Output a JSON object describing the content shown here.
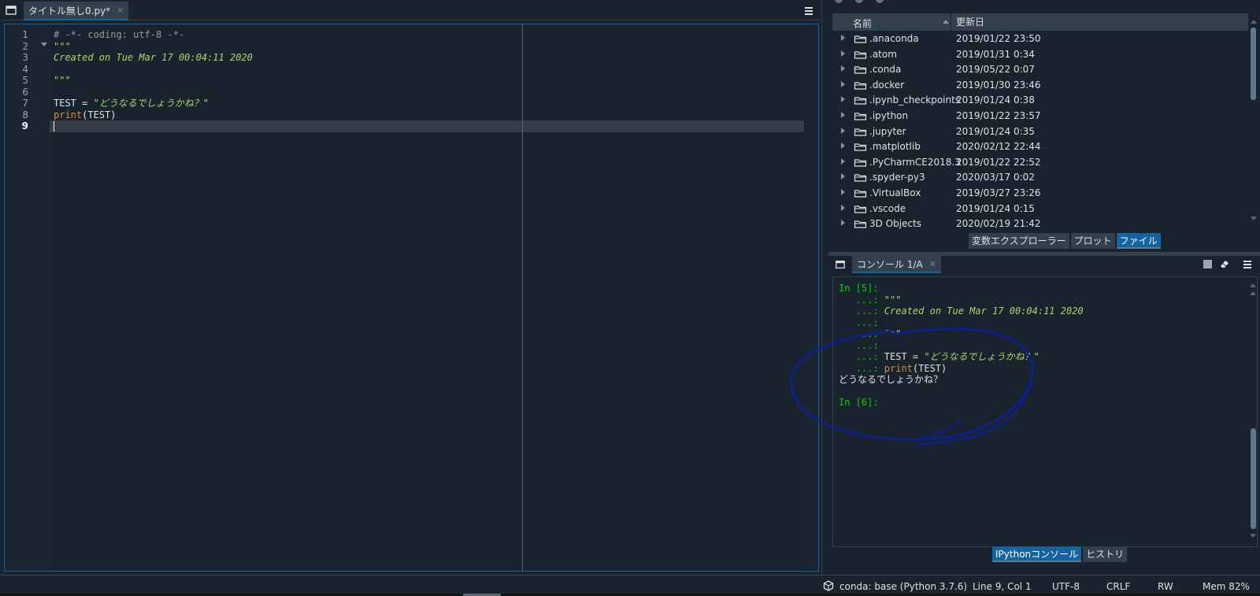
{
  "editor": {
    "tab_title": "タイトル無し0.py*",
    "line_numbers": [
      "1",
      "2",
      "3",
      "4",
      "5",
      "6",
      "7",
      "8",
      "9"
    ],
    "current_line": "9",
    "code": {
      "line1": "# -*- coding: utf-8 -*-",
      "line2": "\"\"\"",
      "line3": "Created on Tue Mar 17 00:04:11 2020",
      "line5": "\"\"\"",
      "line7_var": "TEST = ",
      "line7_str": "\"どうなるでしょうかね？\"",
      "line8_builtin": "print",
      "line8_rest": "(TEST)"
    }
  },
  "files": {
    "col_name": "名前",
    "col_date": "更新日",
    "items": [
      {
        "name": ".anaconda",
        "date": "2019/01/22 23:50"
      },
      {
        "name": ".atom",
        "date": "2019/01/31 0:34"
      },
      {
        "name": ".conda",
        "date": "2019/05/22 0:07"
      },
      {
        "name": ".docker",
        "date": "2019/01/30 23:46"
      },
      {
        "name": ".ipynb_checkpoints",
        "date": "2019/01/24 0:38"
      },
      {
        "name": ".ipython",
        "date": "2019/01/22 23:57"
      },
      {
        "name": ".jupyter",
        "date": "2019/01/24 0:35"
      },
      {
        "name": ".matplotlib",
        "date": "2020/02/12 22:44"
      },
      {
        "name": ".PyCharmCE2018.3",
        "date": "2019/01/22 22:52"
      },
      {
        "name": ".spyder-py3",
        "date": "2020/03/17 0:02"
      },
      {
        "name": ".VirtualBox",
        "date": "2019/03/27 23:26"
      },
      {
        "name": ".vscode",
        "date": "2019/01/24 0:15"
      },
      {
        "name": "3D Objects",
        "date": "2020/02/19 21:42"
      }
    ],
    "bottom_tabs": [
      "変数エクスプローラー",
      "プロット",
      "ファイル"
    ]
  },
  "console": {
    "tab_title": "コンソール 1/A",
    "prompt_in": "In [5]:",
    "cont_prefix": "   ...: ",
    "cont_line1": "\"\"\"",
    "cont_line2": "Created on Tue Mar 17 00:04:11 2020",
    "cont_line4": "\"\"\"",
    "cont_line6_var": "TEST = ",
    "cont_line6_str": "\"どうなるでしょうかね？\"",
    "cont_line7_builtin": "print",
    "cont_line7_rest": "(TEST)",
    "output": "どうなるでしょうかね？",
    "prompt_next": "In [6]:",
    "bottom_tabs": [
      "IPythonコンソール",
      "ヒストリ"
    ]
  },
  "statusbar": {
    "conda": "conda: base (Python 3.7.6)",
    "position": "Line 9, Col 1",
    "encoding": "UTF-8",
    "eol": "CRLF",
    "permissions": "RW",
    "memory": "Mem 82%"
  },
  "colors": {
    "background": "#19232d",
    "accent": "#1464a0",
    "prompt_green": "#00d400",
    "string_green": "#a8d86b",
    "builtin_orange": "#d88e3a",
    "annotation_blue": "#0a1fa8"
  }
}
